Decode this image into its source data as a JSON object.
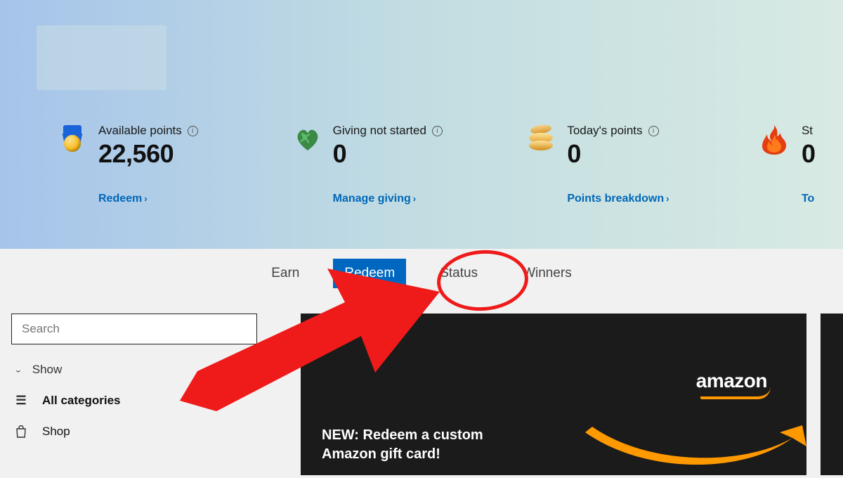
{
  "hero": {
    "stats": [
      {
        "label": "Available points",
        "value": "22,560",
        "link": "Redeem"
      },
      {
        "label": "Giving not started",
        "value": "0",
        "link": "Manage giving"
      },
      {
        "label": "Today's points",
        "value": "0",
        "link": "Points breakdown"
      },
      {
        "label": "St",
        "value": "0",
        "link": "To"
      }
    ]
  },
  "tabs": {
    "items": [
      {
        "label": "Earn",
        "active": false
      },
      {
        "label": "Redeem",
        "active": true
      },
      {
        "label": "Status",
        "active": false
      },
      {
        "label": "Winners",
        "active": false
      }
    ]
  },
  "sidebar": {
    "search_placeholder": "Search",
    "show_label": "Show",
    "categories": [
      {
        "label": "All categories",
        "bold": true
      },
      {
        "label": "Shop",
        "bold": false
      }
    ]
  },
  "card": {
    "brand": "amazon",
    "title_line1": "NEW: Redeem a custom",
    "title_line2": "Amazon gift card!"
  },
  "colors": {
    "accent": "#0067b8",
    "tab_active": "#0067c0",
    "annotation": "#ef1a1a",
    "swoosh": "#ff9900"
  }
}
